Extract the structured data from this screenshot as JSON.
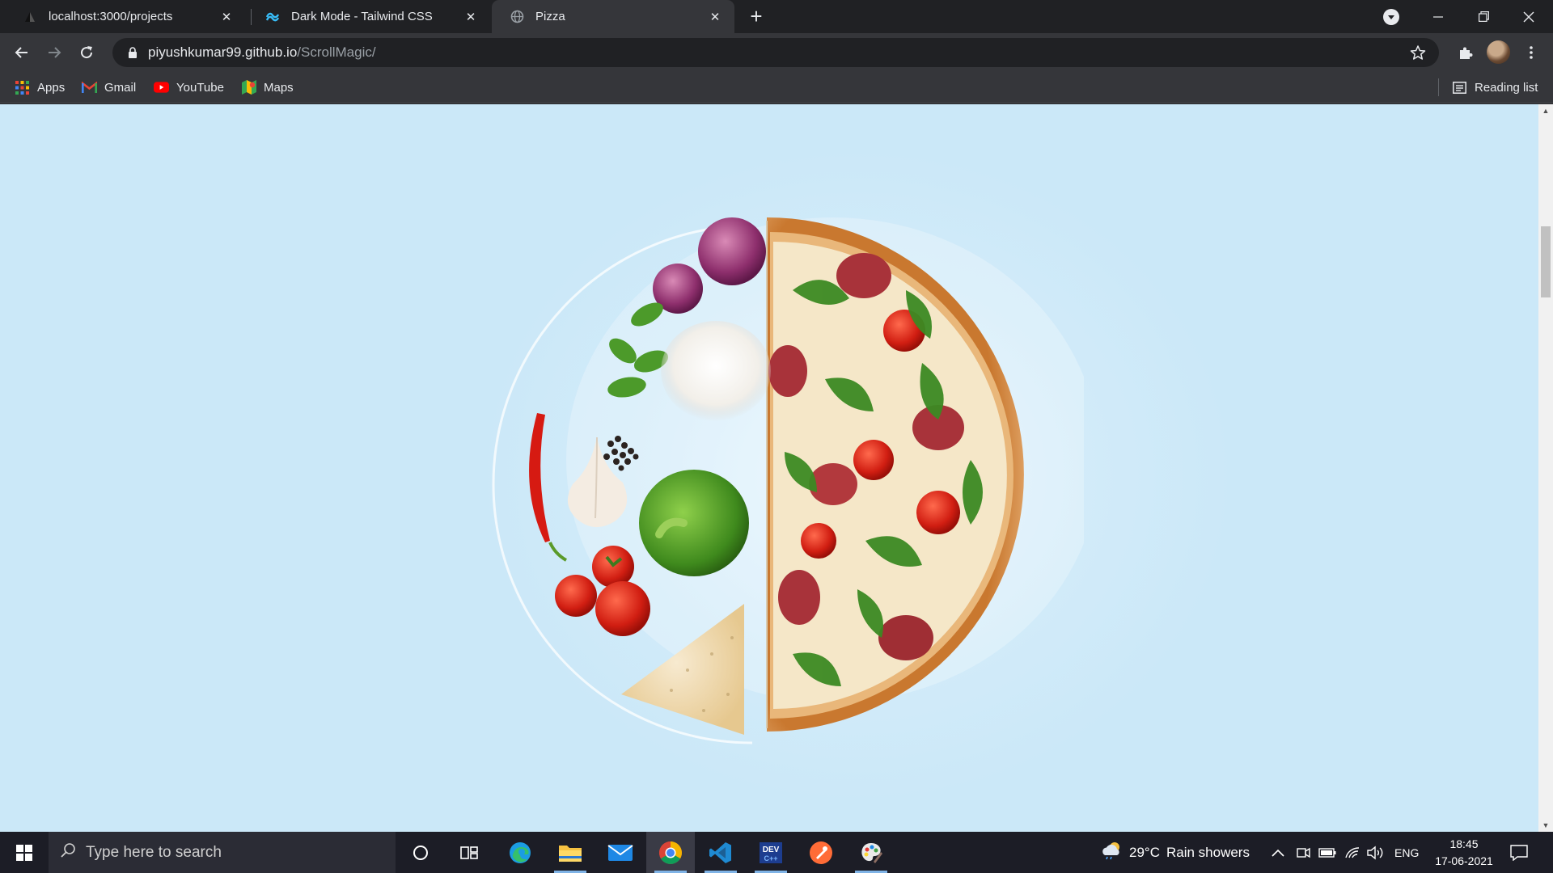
{
  "browser": {
    "tabs": [
      {
        "label": "localhost:3000/projects",
        "favicon": "triangle-icon",
        "active": false
      },
      {
        "label": "Dark Mode - Tailwind CSS",
        "favicon": "tailwind-icon",
        "active": false
      },
      {
        "label": "Pizza",
        "favicon": "globe-icon",
        "active": true
      }
    ],
    "address": {
      "host": "piyushkumar99.github.io",
      "path": "/ScrollMagic/"
    },
    "bookmarks": [
      {
        "label": "Apps",
        "icon": "apps-grid-icon"
      },
      {
        "label": "Gmail",
        "icon": "gmail-icon"
      },
      {
        "label": "YouTube",
        "icon": "youtube-icon"
      },
      {
        "label": "Maps",
        "icon": "maps-icon"
      }
    ],
    "reading_list_label": "Reading list"
  },
  "page": {
    "hero_image": "pizza-half-with-ingredients-image",
    "colors": {
      "background": "#cbe8f8"
    }
  },
  "taskbar": {
    "search_placeholder": "Type here to search",
    "apps": [
      "cortana-icon",
      "task-view-icon",
      "edge-icon",
      "file-explorer-icon",
      "mail-icon",
      "chrome-icon",
      "vscode-icon",
      "devc-icon",
      "postman-icon",
      "paint-icon"
    ],
    "weather": {
      "temp": "29°C",
      "condition": "Rain showers"
    },
    "language": "ENG",
    "time": "18:45",
    "date": "17-06-2021"
  }
}
